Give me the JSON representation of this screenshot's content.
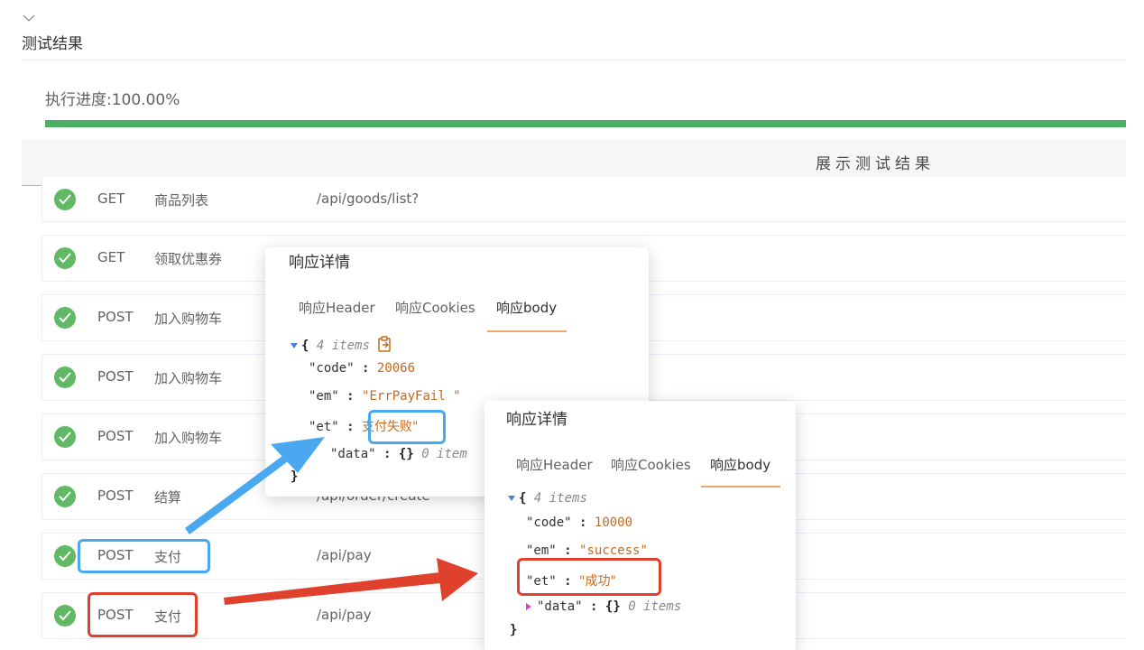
{
  "section": {
    "title": "测试结果"
  },
  "progress": {
    "label": "执行进度:100.00%",
    "value": 1.0,
    "color": "#4caf63"
  },
  "result_bar": {
    "title": "展示测试结果"
  },
  "rows": [
    {
      "method": "GET",
      "name": "商品列表",
      "path": "/api/goods/list?"
    },
    {
      "method": "GET",
      "name": "领取优惠券",
      "path": ""
    },
    {
      "method": "POST",
      "name": "加入购物车",
      "path": ""
    },
    {
      "method": "POST",
      "name": "加入购物车",
      "path": ""
    },
    {
      "method": "POST",
      "name": "加入购物车",
      "path": ""
    },
    {
      "method": "POST",
      "name": "结算",
      "path": "/api/order/create"
    },
    {
      "method": "POST",
      "name": "支付",
      "path": "/api/pay"
    },
    {
      "method": "POST",
      "name": "支付",
      "path": "/api/pay"
    }
  ],
  "panel1": {
    "title": "响应详情",
    "tabs": [
      "响应Header",
      "响应Cookies",
      "响应body"
    ],
    "json": {
      "open": "{",
      "meta": "4 items",
      "code_key": "\"code\"",
      "code_val": "20066",
      "em_key": "\"em\"",
      "em_val": "\"ErrPayFail \"",
      "et_key": "\"et\"",
      "et_val": "支付失败\"",
      "data_key": "\"data\"",
      "data_val": "{}",
      "data_meta": "0 item",
      "close": "}"
    }
  },
  "panel2": {
    "title": "响应详情",
    "tabs": [
      "响应Header",
      "响应Cookies",
      "响应body"
    ],
    "json": {
      "open": "{",
      "meta": "4 items",
      "code_key": "\"code\"",
      "code_val": "10000",
      "em_key": "\"em\"",
      "em_val": "\"success\"",
      "et_key": "\"et\"",
      "et_val": "\"成功\"",
      "data_key": "\"data\"",
      "data_val": "{}",
      "data_meta": "0 items",
      "close": "}"
    }
  },
  "colors": {
    "accent": "#f0a66b",
    "success": "#61b965",
    "highlight_blue": "#4aa8f0",
    "highlight_red": "#e0412c"
  }
}
